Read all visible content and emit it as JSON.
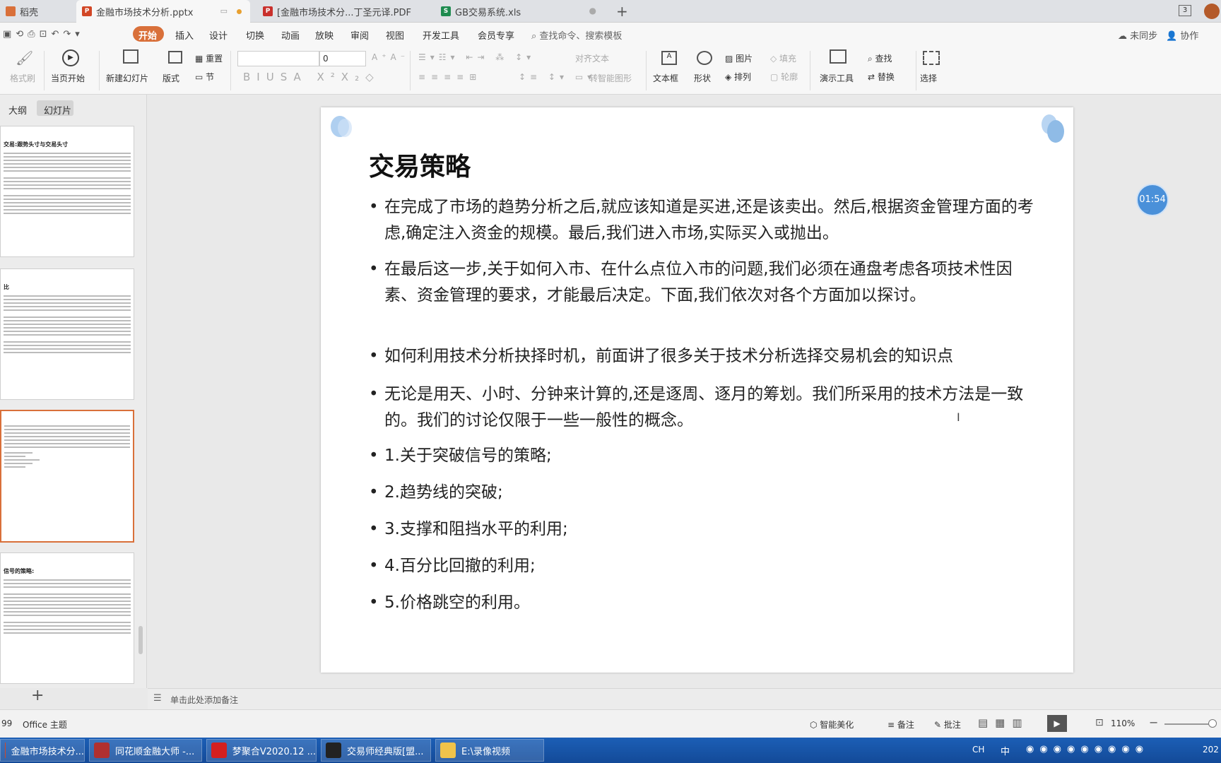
{
  "tabs": [
    {
      "label": "稻壳"
    },
    {
      "label": "金融市场技术分析.pptx"
    },
    {
      "label": "[金融市场技术分...丁圣元译.PDF"
    },
    {
      "label": "GB交易系统.xls"
    }
  ],
  "tab_new": "+",
  "titlebar_badge": "3",
  "menu": {
    "items": [
      "开始",
      "插入",
      "设计",
      "切换",
      "动画",
      "放映",
      "审阅",
      "视图",
      "开发工具",
      "会员专享"
    ],
    "search": "查找命令、搜索模板",
    "sync": "未同步",
    "collab": "协作"
  },
  "ribbon": {
    "format_painter": "格式刷",
    "play_from_current": "当页开始",
    "new_slide": "新建幻灯片",
    "layout": "版式",
    "reset": "重置",
    "section": "节",
    "font_size": "0",
    "align_text": "对齐文本",
    "smart_art": "转智能图形",
    "textbox": "文本框",
    "shape": "形状",
    "picture": "图片",
    "arrange": "排列",
    "fill": "填充",
    "outline": "轮廓",
    "presenter": "演示工具",
    "find": "查找",
    "replace": "替换",
    "select": "选择"
  },
  "left_tabs": [
    "大纲",
    "幻灯片"
  ],
  "thumbnails": [
    {
      "title": "交易:跟势头寸与交易头寸",
      "selected": false
    },
    {
      "title": "比",
      "selected": false
    },
    {
      "title": "",
      "selected": true
    },
    {
      "title": "信号的策略:",
      "selected": false
    }
  ],
  "add_slide": "+",
  "timer": "01:54",
  "slide": {
    "title": "交易策略",
    "bullets": [
      "在完成了市场的趋势分析之后,就应该知道是买进,还是该卖出。然后,根据资金管理方面的考虑,确定注入资金的规模。最后,我们进入市场,实际买入或抛出。",
      "在最后这一步,关于如何入市、在什么点位入市的问题,我们必须在通盘考虑各项技术性因素、资金管理的要求，才能最后决定。下面,我们依次对各个方面加以探讨。",
      "如何利用技术分析抉择时机，前面讲了很多关于技术分析选择交易机会的知识点",
      "无论是用天、小时、分钟来计算的,还是逐周、逐月的筹划。我们所采用的技术方法是一致的。我们的讨论仅限于一些一般性的概念。",
      "1.关于突破信号的策略;",
      "2.趋势线的突破;",
      "3.支撑和阻挡水平的利用;",
      "4.百分比回撤的利用;",
      "5.价格跳空的利用。"
    ]
  },
  "notes_placeholder": "单击此处添加备注",
  "status": {
    "slide_num": "99",
    "theme": "Office 主题",
    "beautify": "智能美化",
    "notes": "备注",
    "comment": "批注",
    "zoom": "110%"
  },
  "taskbar": {
    "items": [
      "金融市场技术分...",
      "同花顺金融大师 -...",
      "梦聚合V2020.12 ...",
      "交易师经典版[盟...",
      "E:\\录像视频"
    ],
    "ime": [
      "CH",
      "中"
    ],
    "clock": "202"
  },
  "colors": {
    "accent": "#d9703a",
    "taskbar": "#1a56a8",
    "timer": "#4a90d9"
  }
}
